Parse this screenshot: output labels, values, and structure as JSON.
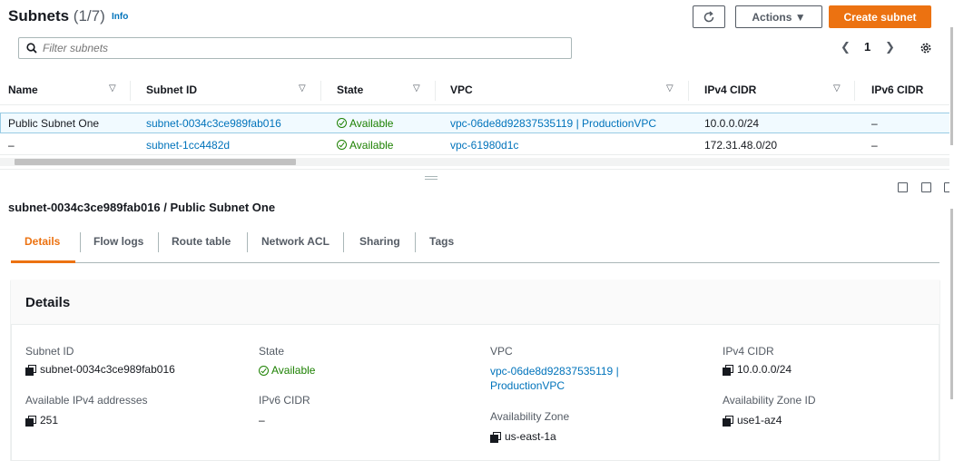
{
  "header": {
    "title": "Subnets",
    "count": "(1/7)",
    "info": "Info",
    "actions_label": "Actions ▼",
    "create_label": "Create subnet",
    "refresh_icon": "refresh-icon",
    "search_placeholder": "Filter subnets",
    "page": "1"
  },
  "table": {
    "columns": [
      "Name",
      "Subnet ID",
      "State",
      "VPC",
      "IPv4 CIDR",
      "IPv6 CIDR"
    ],
    "rows": [
      {
        "name": "Public Subnet One",
        "subnet_id": "subnet-0034c3ce989fab016",
        "state": "Available",
        "vpc": "vpc-06de8d92837535119 | ProductionVPC",
        "ipv4": "10.0.0.0/24",
        "ipv6": "–"
      },
      {
        "name": "–",
        "subnet_id": "subnet-1cc4482d",
        "state": "Available",
        "vpc": "vpc-61980d1c",
        "ipv4": "172.31.48.0/20",
        "ipv6": "–"
      }
    ]
  },
  "detail": {
    "title": "subnet-0034c3ce989fab016 / Public Subnet One",
    "tabs": [
      "Details",
      "Flow logs",
      "Route table",
      "Network ACL",
      "Sharing",
      "Tags"
    ],
    "card_title": "Details",
    "fields": {
      "subnet_id_label": "Subnet ID",
      "subnet_id": "subnet-0034c3ce989fab016",
      "avail_ipv4_label": "Available IPv4 addresses",
      "avail_ipv4": "251",
      "state_label": "State",
      "state": "Available",
      "ipv6_label": "IPv6 CIDR",
      "ipv6": "–",
      "vpc_label": "VPC",
      "vpc_line1": "vpc-06de8d92837535119 |",
      "vpc_line2": "ProductionVPC",
      "az_label": "Availability Zone",
      "az": "us-east-1a",
      "ipv4_cidr_label": "IPv4 CIDR",
      "ipv4_cidr": "10.0.0.0/24",
      "az_id_label": "Availability Zone ID",
      "az_id": "use1-az4"
    }
  },
  "colors": {
    "accent": "#ec7211",
    "link": "#0073bb",
    "success": "#1d8102"
  }
}
